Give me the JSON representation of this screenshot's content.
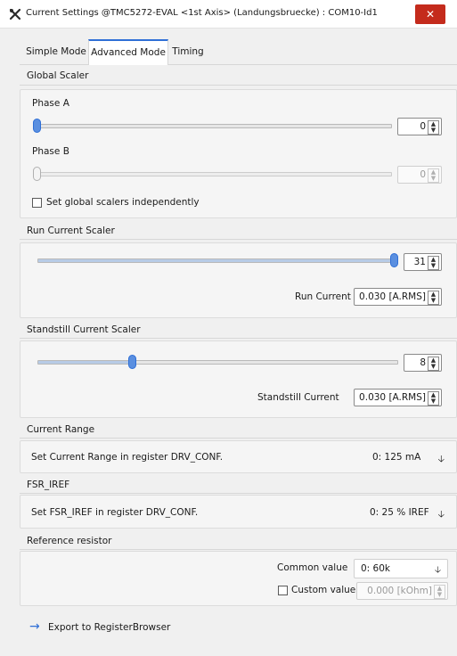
{
  "window": {
    "title": "Current Settings @TMC5272-EVAL <1st Axis> (Landungsbruecke) : COM10-Id1",
    "close_glyph": "✕",
    "app_icon": "tools-icon"
  },
  "tabs": [
    {
      "label": "Simple Mode",
      "active": false
    },
    {
      "label": "Advanced Mode",
      "active": true
    },
    {
      "label": "Timing",
      "active": false
    }
  ],
  "global_scaler": {
    "title": "Global Scaler",
    "phase_a": {
      "label": "Phase A",
      "value": "0",
      "level": 0,
      "enabled": true
    },
    "phase_b": {
      "label": "Phase B",
      "value": "0",
      "level": 0,
      "enabled": false
    },
    "independent_label": "Set global scalers independently",
    "independent_checked": false
  },
  "run_current_scaler": {
    "title": "Run Current Scaler",
    "value": "31",
    "max": 31,
    "level": 31,
    "current_label": "Run Current",
    "current_value": "0.030 [A.RMS]"
  },
  "standstill_current_scaler": {
    "title": "Standstill Current Scaler",
    "value": "8",
    "max": 31,
    "level": 8,
    "current_label": "Standstill Current",
    "current_value": "0.030 [A.RMS]"
  },
  "current_range": {
    "title": "Current Range",
    "label": "Set Current Range in register DRV_CONF.",
    "selected": "0: 125 mA"
  },
  "fsr_iref": {
    "title": "FSR_IREF",
    "label": "Set FSR_IREF in register DRV_CONF.",
    "selected": "0: 25 % IREF"
  },
  "reference_resistor": {
    "title": "Reference resistor",
    "common_label": "Common value",
    "common_selected": "0: 60k",
    "custom_label": "Custom value",
    "custom_checked": false,
    "custom_value": "0.000 [kOhm]"
  },
  "export": {
    "label": "Export to RegisterBrowser",
    "icon": "arrow-right-icon"
  },
  "colors": {
    "accent": "#2f6fd6",
    "close_button": "#c42b1c"
  }
}
